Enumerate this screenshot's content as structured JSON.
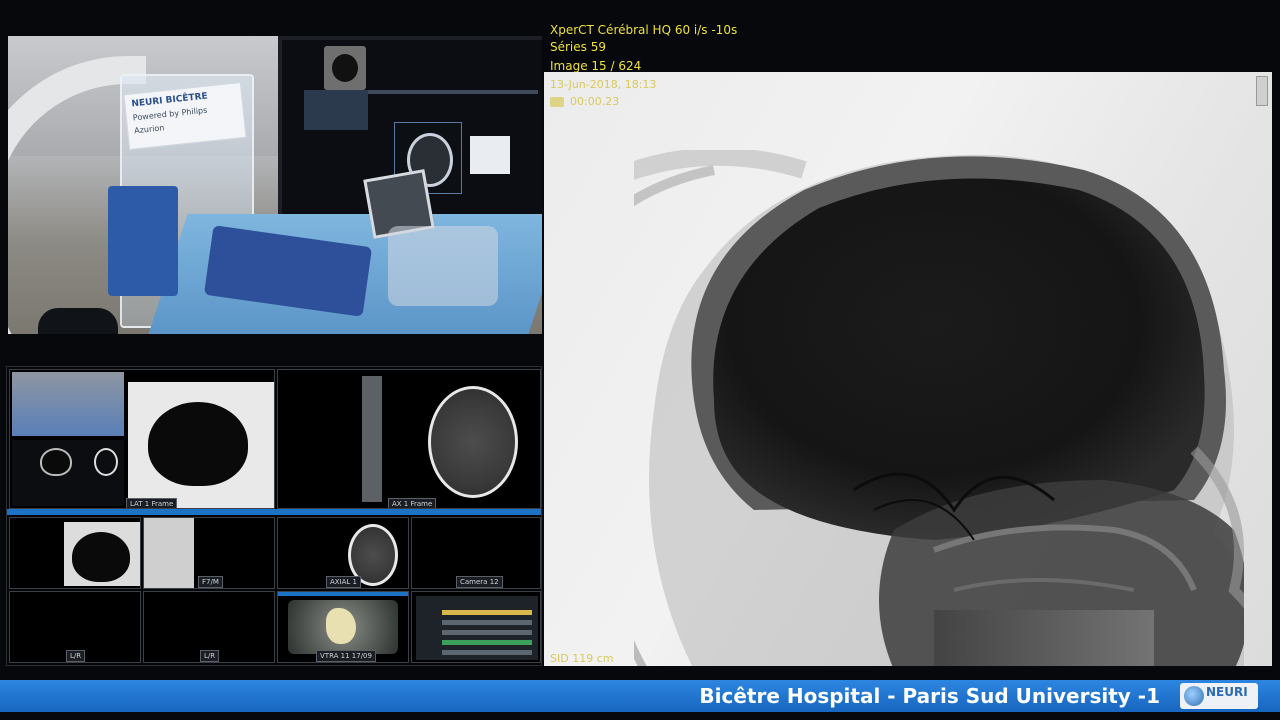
{
  "header": {
    "line1": "XperCT Cérébral HQ 60 i/s -10s",
    "line2": "Séries 59",
    "line3": "Image 15 / 624"
  },
  "xray": {
    "timestamp": "13-Jun-2018, 18:13",
    "elapsed": "00:00.23",
    "bottom_label": "SID  119 cm"
  },
  "camera": {
    "sign_title": "NEURI BICÊTRE",
    "sign_subtitle": "Powered by Philips Azurion"
  },
  "mosaic": {
    "tile_labels": {
      "lateral": "LAT  1 Frame",
      "axial": "AX  1 Frame",
      "lat2": "F7/M",
      "axial2": "AXIAL 1",
      "camera": "Camera  12",
      "a1": "L/R",
      "a2": "L/R",
      "vessels": "VTRA 11 17/09"
    }
  },
  "banner": {
    "text": "Bicêtre Hospital - Paris Sud University -1",
    "logo_text": "NEURI"
  },
  "colors": {
    "banner_blue": "#1c73c6",
    "overlay_yellow": "#f1e23a"
  }
}
